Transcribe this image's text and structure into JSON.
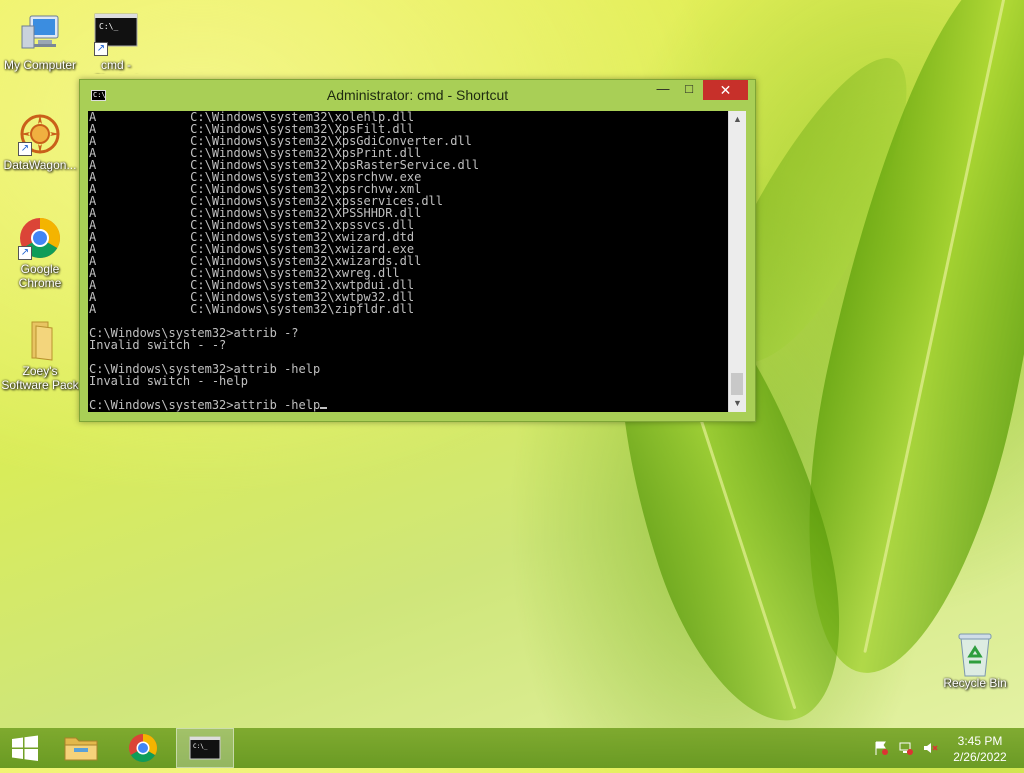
{
  "desktop": {
    "icons": [
      {
        "label": "My Computer"
      },
      {
        "label": "cmd -\nShortcut"
      },
      {
        "label": "DataWagon..."
      },
      {
        "label": "Google\nChrome"
      },
      {
        "label": "Zoey's\nSoftware Pack"
      },
      {
        "label": "Recycle Bin"
      }
    ]
  },
  "window": {
    "title": "Administrator: cmd - Shortcut",
    "icon_text": "C:\\",
    "controls": {
      "minimize": "—",
      "maximize": "□",
      "close": "✕"
    },
    "console_text": "A             C:\\Windows\\system32\\xolehlp.dll\nA             C:\\Windows\\system32\\XpsFilt.dll\nA             C:\\Windows\\system32\\XpsGdiConverter.dll\nA             C:\\Windows\\system32\\XpsPrint.dll\nA             C:\\Windows\\system32\\XpsRasterService.dll\nA             C:\\Windows\\system32\\xpsrchvw.exe\nA             C:\\Windows\\system32\\xpsrchvw.xml\nA             C:\\Windows\\system32\\xpsservices.dll\nA             C:\\Windows\\system32\\XPSSHHDR.dll\nA             C:\\Windows\\system32\\xpssvcs.dll\nA             C:\\Windows\\system32\\xwizard.dtd\nA             C:\\Windows\\system32\\xwizard.exe\nA             C:\\Windows\\system32\\xwizards.dll\nA             C:\\Windows\\system32\\xwreg.dll\nA             C:\\Windows\\system32\\xwtpdui.dll\nA             C:\\Windows\\system32\\xwtpw32.dll\nA             C:\\Windows\\system32\\zipfldr.dll\n\nC:\\Windows\\system32>attrib -?\nInvalid switch - -?\n\nC:\\Windows\\system32>attrib -help\nInvalid switch - -help\n\nC:\\Windows\\system32>attrib -help"
  },
  "taskbar": {
    "clock_time": "3:45 PM",
    "clock_date": "2/26/2022",
    "pinned": [
      "file-explorer-icon",
      "chrome-icon",
      "cmd-icon"
    ]
  },
  "colors": {
    "window_frame": "#a9cf56",
    "close_button": "#c7302a",
    "console_bg": "#000000",
    "console_fg": "#c0c0c0"
  }
}
